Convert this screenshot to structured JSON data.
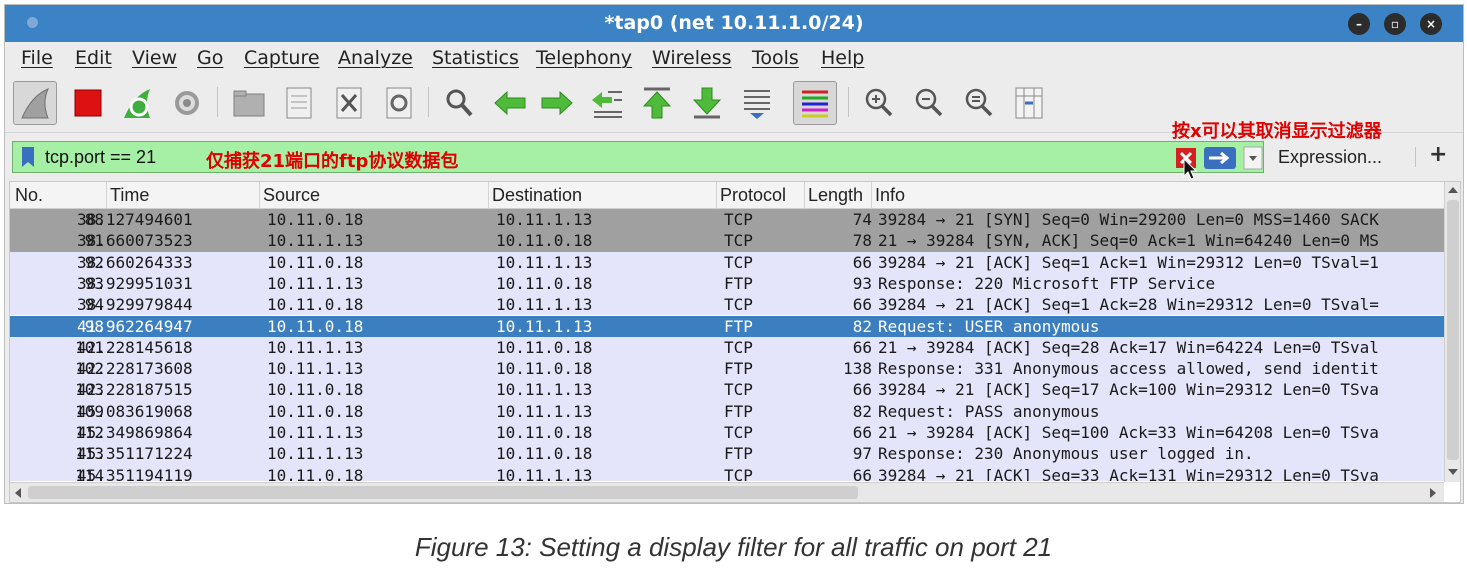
{
  "window": {
    "title": "*tap0 (net 10.11.1.0/24)"
  },
  "menu": [
    "File",
    "Edit",
    "View",
    "Go",
    "Capture",
    "Analyze",
    "Statistics",
    "Telephony",
    "Wireless",
    "Tools",
    "Help"
  ],
  "toolbar_icons": [
    "shark-fin-icon",
    "stop-icon",
    "restart-icon",
    "options-gear-icon",
    "open-folder-icon",
    "save-file-icon",
    "close-file-icon",
    "reload-icon",
    "find-icon",
    "back-arrow-icon",
    "forward-arrow-icon",
    "go-to-packet-icon",
    "first-packet-icon",
    "last-packet-icon",
    "autoscroll-icon",
    "colorize-icon",
    "zoom-in-icon",
    "zoom-out-icon",
    "zoom-normal-icon",
    "resize-columns-icon"
  ],
  "filter": {
    "value": "tcp.port == 21",
    "note": "仅捕获21端口的ftp协议数据包",
    "clear_tip": "按x可以其取消显示过滤器",
    "expression_label": "Expression...",
    "plus_label": "+"
  },
  "columns": [
    "No.",
    "Time",
    "Source",
    "Destination",
    "Protocol",
    "Length",
    "Info"
  ],
  "packets": [
    {
      "no": "88",
      "time": "38.127494601",
      "src": "10.11.0.18",
      "dst": "10.11.1.13",
      "proto": "TCP",
      "len": "74",
      "info": "39284 → 21 [SYN] Seq=0 Win=29200 Len=0 MSS=1460 SACK",
      "style": "gray"
    },
    {
      "no": "91",
      "time": "38.660073523",
      "src": "10.11.1.13",
      "dst": "10.11.0.18",
      "proto": "TCP",
      "len": "78",
      "info": "21 → 39284 [SYN, ACK] Seq=0 Ack=1 Win=64240 Len=0 MS",
      "style": "gray"
    },
    {
      "no": "92",
      "time": "38.660264333",
      "src": "10.11.0.18",
      "dst": "10.11.1.13",
      "proto": "TCP",
      "len": "66",
      "info": "39284 → 21 [ACK] Seq=1 Ack=1 Win=29312 Len=0 TSval=1",
      "style": "lav"
    },
    {
      "no": "93",
      "time": "38.929951031",
      "src": "10.11.1.13",
      "dst": "10.11.0.18",
      "proto": "FTP",
      "len": "93",
      "info": "Response: 220 Microsoft FTP Service",
      "style": "lav"
    },
    {
      "no": "94",
      "time": "38.929979844",
      "src": "10.11.0.18",
      "dst": "10.11.1.13",
      "proto": "TCP",
      "len": "66",
      "info": "39284 → 21 [ACK] Seq=1 Ack=28 Win=29312 Len=0 TSval=",
      "style": "lav"
    },
    {
      "no": "98",
      "time": "41.962264947",
      "src": "10.11.0.18",
      "dst": "10.11.1.13",
      "proto": "FTP",
      "len": "82",
      "info": "Request: USER anonymous",
      "style": "sel"
    },
    {
      "no": "101",
      "time": "42.228145618",
      "src": "10.11.1.13",
      "dst": "10.11.0.18",
      "proto": "TCP",
      "len": "66",
      "info": "21 → 39284 [ACK] Seq=28 Ack=17 Win=64224 Len=0 TSval",
      "style": "lav"
    },
    {
      "no": "102",
      "time": "42.228173608",
      "src": "10.11.1.13",
      "dst": "10.11.0.18",
      "proto": "FTP",
      "len": "138",
      "info": "Response: 331 Anonymous access allowed, send identit",
      "style": "lav"
    },
    {
      "no": "103",
      "time": "42.228187515",
      "src": "10.11.0.18",
      "dst": "10.11.1.13",
      "proto": "TCP",
      "len": "66",
      "info": "39284 → 21 [ACK] Seq=17 Ack=100 Win=29312 Len=0 TSva",
      "style": "lav"
    },
    {
      "no": "109",
      "time": "45.083619068",
      "src": "10.11.0.18",
      "dst": "10.11.1.13",
      "proto": "FTP",
      "len": "82",
      "info": "Request: PASS anonymous",
      "style": "lav"
    },
    {
      "no": "112",
      "time": "45.349869864",
      "src": "10.11.1.13",
      "dst": "10.11.0.18",
      "proto": "TCP",
      "len": "66",
      "info": "21 → 39284 [ACK] Seq=100 Ack=33 Win=64208 Len=0 TSva",
      "style": "lav"
    },
    {
      "no": "113",
      "time": "45.351171224",
      "src": "10.11.1.13",
      "dst": "10.11.0.18",
      "proto": "FTP",
      "len": "97",
      "info": "Response: 230 Anonymous user logged in.",
      "style": "lav"
    },
    {
      "no": "114",
      "time": "45.351194119",
      "src": "10.11.0.18",
      "dst": "10.11.1.13",
      "proto": "TCP",
      "len": "66",
      "info": "39284 → 21 [ACK] Seq=33 Ack=131 Win=29312 Len=0 TSva",
      "style": "lav"
    }
  ],
  "caption": "Figure 13: Setting a display filter for all traffic on port 21",
  "colors": {
    "titlebar": "#3c83c6",
    "filter_bg": "#a6f0a6",
    "selected_row": "#3b7fc1",
    "tcp_row": "#e4e4fa",
    "syn_row": "#a0a0a0",
    "annotation": "#e00000"
  }
}
